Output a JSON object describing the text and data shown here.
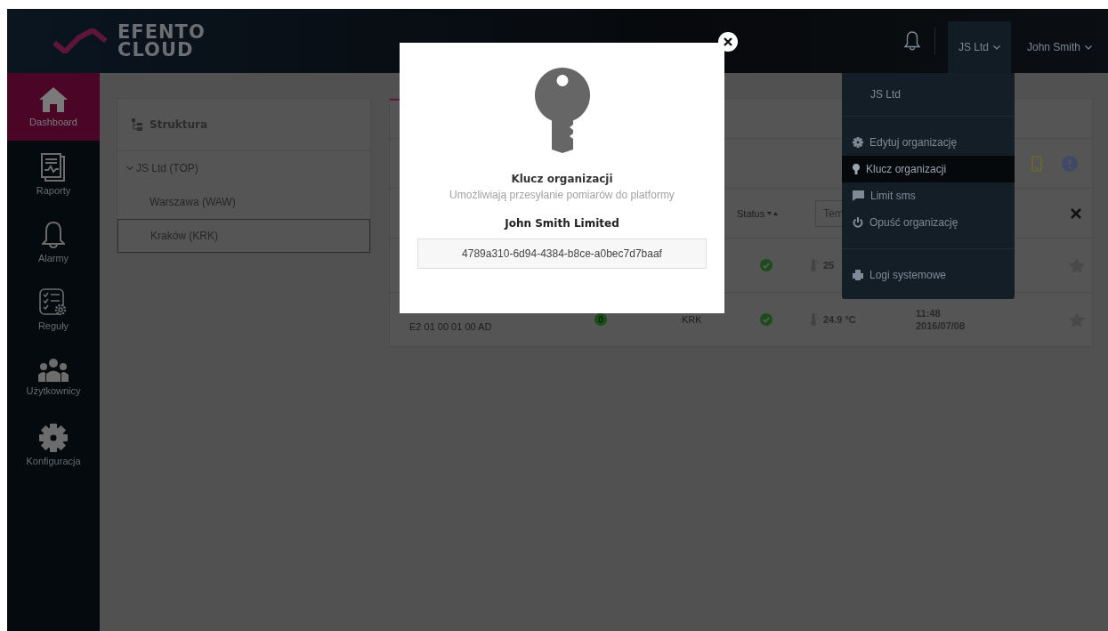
{
  "logo": {
    "line1": "EFENTO",
    "line2": "CLOUD"
  },
  "topbar": {
    "org_menu": "JS Ltd",
    "user_menu": "John Smith",
    "org_menu_open": true
  },
  "sidebar": {
    "items": [
      {
        "label": "Dashboard",
        "kind": "home",
        "selected": true
      },
      {
        "label": "Raporty",
        "kind": "report",
        "selected": false
      },
      {
        "label": "Alarmy",
        "kind": "bell",
        "selected": false
      },
      {
        "label": "Reguły",
        "kind": "rules",
        "selected": false
      },
      {
        "label": "Użytkownicy",
        "kind": "users",
        "selected": false
      },
      {
        "label": "Konfiguracja",
        "kind": "gear",
        "selected": false
      }
    ]
  },
  "structure": {
    "title": "Struktura",
    "tree": [
      {
        "label": "JS Ltd (TOP)",
        "expanded": true,
        "selected": false,
        "children": [
          {
            "label": "Warszawa (WAW)",
            "selected": false
          },
          {
            "label": "Kraków (KRK)",
            "selected": true
          }
        ]
      }
    ]
  },
  "table": {
    "header": {
      "status": "Status",
      "filter_value": "Tem"
    },
    "rows": [
      {
        "status_ok": true,
        "temperature": "25",
        "starred": false
      },
      {
        "device_id": "E2 01 00 01 00 AD",
        "alarms": "0",
        "location": "KRK",
        "status_ok": true,
        "temperature": "24.9 °C",
        "time": "11:48",
        "date": "2016/07/08",
        "starred": false
      }
    ]
  },
  "org_menu": {
    "header": "JS Ltd",
    "items": [
      {
        "label": "Edytuj organizację",
        "kind": "gear",
        "selected": false
      },
      {
        "label": "Klucz organizacji",
        "kind": "key",
        "selected": true
      },
      {
        "label": "Limit sms",
        "kind": "chat",
        "selected": false
      },
      {
        "label": "Opuść organizację",
        "kind": "power",
        "selected": false
      },
      {
        "label": "Logi systemowe",
        "kind": "print",
        "selected": false
      }
    ]
  },
  "modal": {
    "title": "Klucz organizacji",
    "subtitle": "Umożliwiają przesyłanie pomiarów do platformy",
    "org_name": "John Smith Limited",
    "key": "4789a310-6d94-4384-b8ce-a0bec7d7baaf"
  }
}
